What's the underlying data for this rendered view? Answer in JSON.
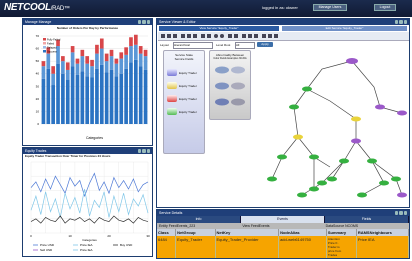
{
  "app": {
    "brand": "NETCOOL",
    "brand_suffix": "/RAD™"
  },
  "header": {
    "logged_in": "logged in as: oksner",
    "btn1": "Manage Users",
    "btn2": "Logout"
  },
  "panel_bar": {
    "title": "Number of Orders Per Day by Performance",
    "window_title": "Manage Manage",
    "legend": [
      "Fully Failed",
      "Failed",
      "Delayed",
      "Success"
    ],
    "xlabel": "Categories"
  },
  "panel_line": {
    "window_title": "Equity Trades",
    "title": "Equity Trader Transaction Over Timer for Previous 24 Hours",
    "xlabel": "Categories",
    "legend": [
      "Price USD",
      "Price IEA",
      "Buy USD",
      "Sell USD",
      "Price IEA"
    ]
  },
  "panel_topo": {
    "window_title": "Service Viewer & Editor",
    "toolbar_title": "View Service \"Equity_Trader\"",
    "toolbar_right": "Edit Service \"Equity_Trader\"",
    "layout_label": "Layout",
    "layout_value": "Hierarchical",
    "level_label": "Level Root",
    "level_value": "All",
    "apply": "Apply",
    "legend_left_title": "Service State",
    "legend_left_sub": "Service Fields",
    "legend_right_title": "Abnormality Between",
    "legend_right_sub": "Color Fields Examples 30-60s",
    "side_items": [
      "Equity Trader",
      "Equity Trader",
      "Equity Trader",
      "Equity Trader"
    ]
  },
  "panel_details": {
    "window_title": "Service Details",
    "tabs": [
      "Info",
      "Events",
      "Fields"
    ],
    "headers": [
      "Class",
      "NetGroup",
      "NetKey",
      "NodeAlias",
      "Summary",
      "RAMSNeighbours"
    ],
    "row": [
      "6484",
      "Equity_Trader",
      "Equity_Trader_Provider",
      "add-web6149750",
      "develop-alias-ser",
      "Price IEA"
    ],
    "summary_wrap": [
      "Attention",
      "Price fr-",
      "Trader is",
      "price from",
      "Trades"
    ],
    "top_labels": [
      "Entity  FeedEvents_223",
      "View  FeedEvents",
      "DataSource  NCOMS"
    ]
  },
  "chart_data": [
    {
      "type": "bar",
      "title": "Number of Orders Per Day by Performance",
      "xlabel": "Categories",
      "ylabel": "",
      "series": [
        {
          "name": "Fully Failed",
          "values": [
            4,
            5,
            6,
            5,
            4,
            6,
            5,
            4,
            5,
            6,
            5,
            7,
            8,
            6,
            5,
            4,
            5,
            6,
            7,
            8,
            6,
            5
          ]
        },
        {
          "name": "Failed",
          "values": [
            10,
            12,
            9,
            14,
            10,
            8,
            11,
            9,
            12,
            10,
            9,
            12,
            13,
            9,
            11,
            10,
            12,
            11,
            13,
            12,
            10,
            11
          ]
        },
        {
          "name": "Success",
          "values": [
            36,
            44,
            31,
            48,
            40,
            35,
            46,
            39,
            42,
            38,
            37,
            44,
            47,
            41,
            43,
            38,
            40,
            44,
            49,
            51,
            46,
            43
          ]
        }
      ],
      "ylim": [
        0,
        70
      ]
    },
    {
      "type": "line",
      "title": "Equity Trader Transaction Over Timer for Previous 24 Hours",
      "xlabel": "Categories",
      "x": [
        "0",
        "10",
        "20",
        "30"
      ],
      "series": [
        {
          "name": "Price USD",
          "values": [
            3.2,
            3.6,
            2.9,
            3.8,
            3.1,
            4.0,
            3.4,
            2.8,
            3.9,
            3.3,
            3.7,
            2.6,
            3.5,
            4.2,
            3.0,
            3.6,
            2.8,
            3.9,
            3.2,
            3.7,
            3.1,
            3.8,
            2.9,
            3.4,
            3.6
          ]
        },
        {
          "name": "Price IEA",
          "values": [
            1.6,
            2.6,
            1.3,
            2.9,
            1.5,
            2.4,
            1.1,
            2.8,
            1.7,
            2.5,
            1.4,
            3.1,
            1.2,
            2.3,
            1.8,
            2.9,
            1.1,
            2.6,
            1.5,
            2.8,
            1.3,
            2.4,
            1.9,
            2.7,
            1.4
          ]
        },
        {
          "name": "Buy USD",
          "values": [
            0.8,
            1.0,
            0.7,
            1.1,
            0.9,
            0.8,
            1.2,
            0.7,
            1.0,
            0.9,
            1.1,
            0.8,
            1.0,
            0.7,
            1.1,
            0.9,
            0.8,
            1.2,
            0.9,
            0.8,
            1.0,
            0.7,
            1.1,
            0.9,
            0.8
          ]
        }
      ],
      "ylim": [
        0,
        5
      ]
    }
  ],
  "colors": {
    "brand_bar": "#1b2b4d",
    "panel_header": "#1f3f79",
    "orange": "#f6a400",
    "bar_main": "#2b73c2",
    "bar_red": "#d8474a",
    "node_purple": "#9b59c9",
    "node_green": "#35b040",
    "node_yellow": "#e9d33a"
  }
}
